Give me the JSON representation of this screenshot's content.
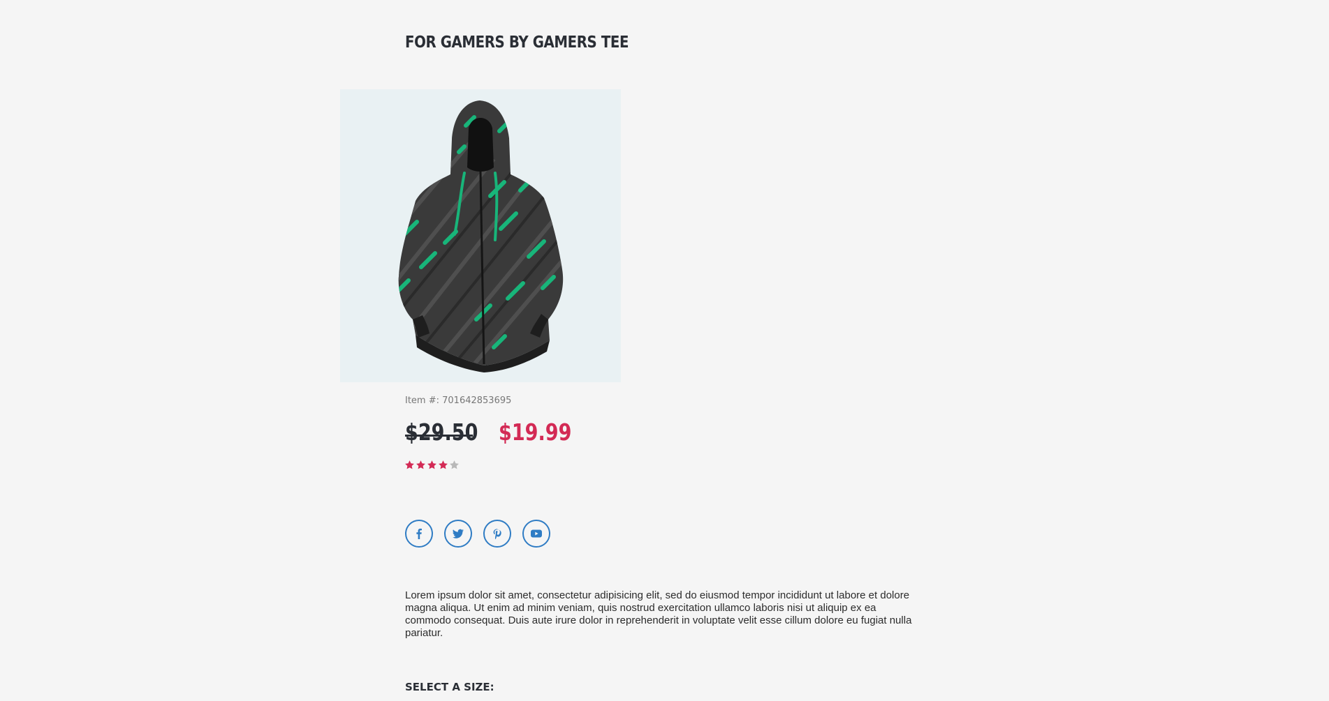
{
  "product": {
    "title": "FOR GAMERS BY GAMERS TEE",
    "image_alt": "Black and green patterned zip hoodie",
    "item_number": "Item #: 701642853695",
    "old_price": "$29.50",
    "new_price": "$19.99",
    "rating": 4,
    "rating_max": 5,
    "description": "Lorem ipsum dolor sit amet, consectetur adipisicing elit, sed do eiusmod tempor incididunt ut labore et dolore magna aliqua. Ut enim ad minim veniam, quis nostrud exercitation ullamco laboris nisi ut aliquip ex ea commodo consequat. Duis aute irure dolor in reprehenderit in voluptate velit esse cillum dolore eu fugiat nulla pariatur.",
    "size_label": "SELECT A SIZE:"
  },
  "social": [
    {
      "icon": "facebook-icon"
    },
    {
      "icon": "twitter-icon"
    },
    {
      "icon": "pinterest-icon"
    },
    {
      "icon": "youtube-icon"
    }
  ],
  "colors": {
    "background": "#f5f5f5",
    "title": "#2a2e35",
    "sale_price": "#d32a55",
    "star_filled": "#d32a55",
    "star_empty": "#b8b8b8",
    "social": "#2f7cc4",
    "image_bg": "#e9f1f3",
    "hoodie_accent": "#18b57a"
  }
}
